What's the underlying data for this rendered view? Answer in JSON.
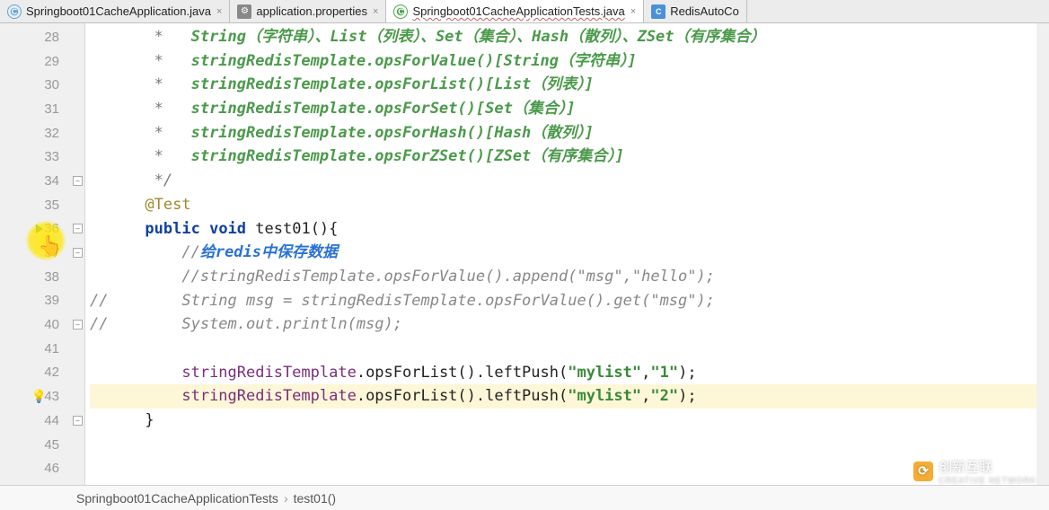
{
  "tabs": [
    {
      "label": "Springboot01CacheApplication.java",
      "icon": "java",
      "active": false
    },
    {
      "label": "application.properties",
      "icon": "props",
      "active": false
    },
    {
      "label": "Springboot01CacheApplicationTests.java",
      "icon": "test",
      "active": true
    },
    {
      "label": "RedisAutoCo",
      "icon": "redis",
      "active": false,
      "noclose": true
    }
  ],
  "gutter": {
    "start": 28,
    "end": 46,
    "run_line": 36,
    "bulb_line": 43,
    "fold_lines": [
      34,
      36,
      37,
      40,
      44
    ]
  },
  "code": {
    "l28": {
      "prefix": "       *   ",
      "text": "String（字符串）、List（列表）、Set（集合）、Hash（散列）、ZSet（有序集合）"
    },
    "l29": {
      "prefix": "       *   ",
      "text": "stringRedisTemplate.opsForValue()[String（字符串）]"
    },
    "l30": {
      "prefix": "       *   ",
      "text": "stringRedisTemplate.opsForList()[List（列表）]"
    },
    "l31": {
      "prefix": "       *   ",
      "text": "stringRedisTemplate.opsForSet()[Set（集合）]"
    },
    "l32": {
      "prefix": "       *   ",
      "text": "stringRedisTemplate.opsForHash()[Hash（散列）]"
    },
    "l33": {
      "prefix": "       *   ",
      "text": "stringRedisTemplate.opsForZSet()[ZSet（有序集合）]"
    },
    "l34": {
      "text": "       */"
    },
    "l35": {
      "text": "      @Test"
    },
    "l36": {
      "kw1": "public",
      "kw2": "void",
      "name": " test01(){"
    },
    "l37": {
      "slash": "          //",
      "text": "给redis中保存数据"
    },
    "l38": {
      "text": "          //stringRedisTemplate.opsForValue().append(\"msg\",\"hello\");"
    },
    "l39": {
      "slash": "//        ",
      "text": "String msg = stringRedisTemplate.opsForValue().get(\"msg\");"
    },
    "l40": {
      "slash": "//        ",
      "text": "System.out.println(msg);"
    },
    "l42": {
      "field": "stringRedisTemplate",
      "call": ".opsForList().leftPush(",
      "s1": "\"mylist\"",
      "c": ",",
      "s2": "\"1\"",
      "end": ");"
    },
    "l43": {
      "field": "stringRedisTemplate",
      "call": ".opsForList().leftPush(",
      "s1": "\"mylist\"",
      "c": ",",
      "s2": "\"2\"",
      "end": ");"
    },
    "l44": {
      "text": "      }"
    }
  },
  "breadcrumb": {
    "class": "Springboot01CacheApplicationTests",
    "method": "test01()"
  },
  "watermark": {
    "brand": "创新互联",
    "sub": "CREATIVE NETWORK"
  }
}
